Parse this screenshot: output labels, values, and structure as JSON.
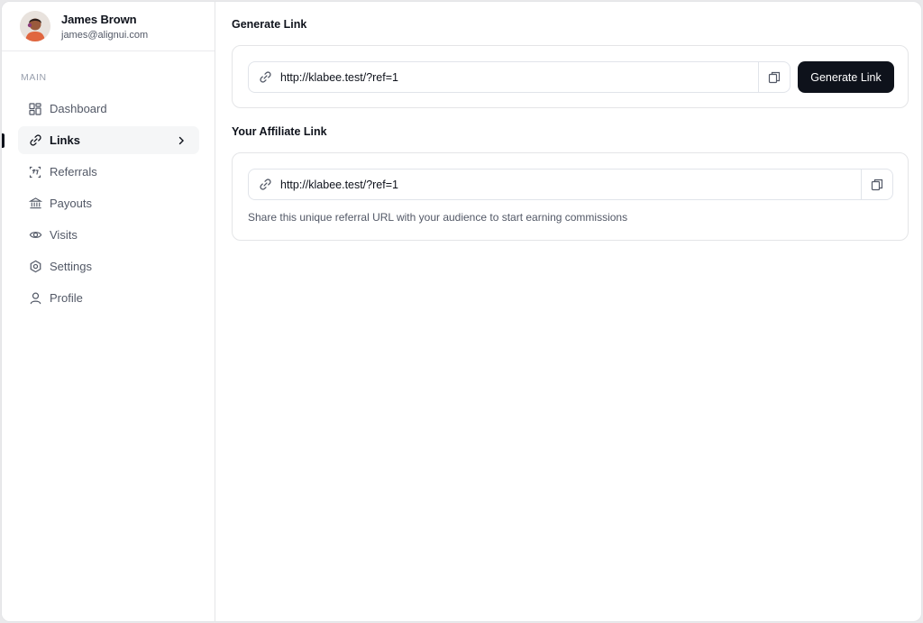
{
  "user": {
    "name": "James Brown",
    "email": "james@alignui.com"
  },
  "sidebar": {
    "section_label": "MAIN",
    "items": [
      {
        "label": "Dashboard",
        "icon": "dashboard-icon"
      },
      {
        "label": "Links",
        "icon": "link-icon",
        "active": true
      },
      {
        "label": "Referrals",
        "icon": "referrals-icon"
      },
      {
        "label": "Payouts",
        "icon": "bank-icon"
      },
      {
        "label": "Visits",
        "icon": "eye-icon"
      },
      {
        "label": "Settings",
        "icon": "gear-icon"
      },
      {
        "label": "Profile",
        "icon": "user-icon"
      }
    ]
  },
  "generate": {
    "heading": "Generate Link",
    "url": "http://klabee.test/?ref=1",
    "button_label": "Generate Link"
  },
  "affiliate": {
    "heading": "Your Affiliate Link",
    "url": "http://klabee.test/?ref=1",
    "hint": "Share this unique referral URL with your audience to start earning commissions"
  },
  "colors": {
    "primary": "#0e121b",
    "muted_text": "#525866",
    "border": "#e4e5e7"
  }
}
